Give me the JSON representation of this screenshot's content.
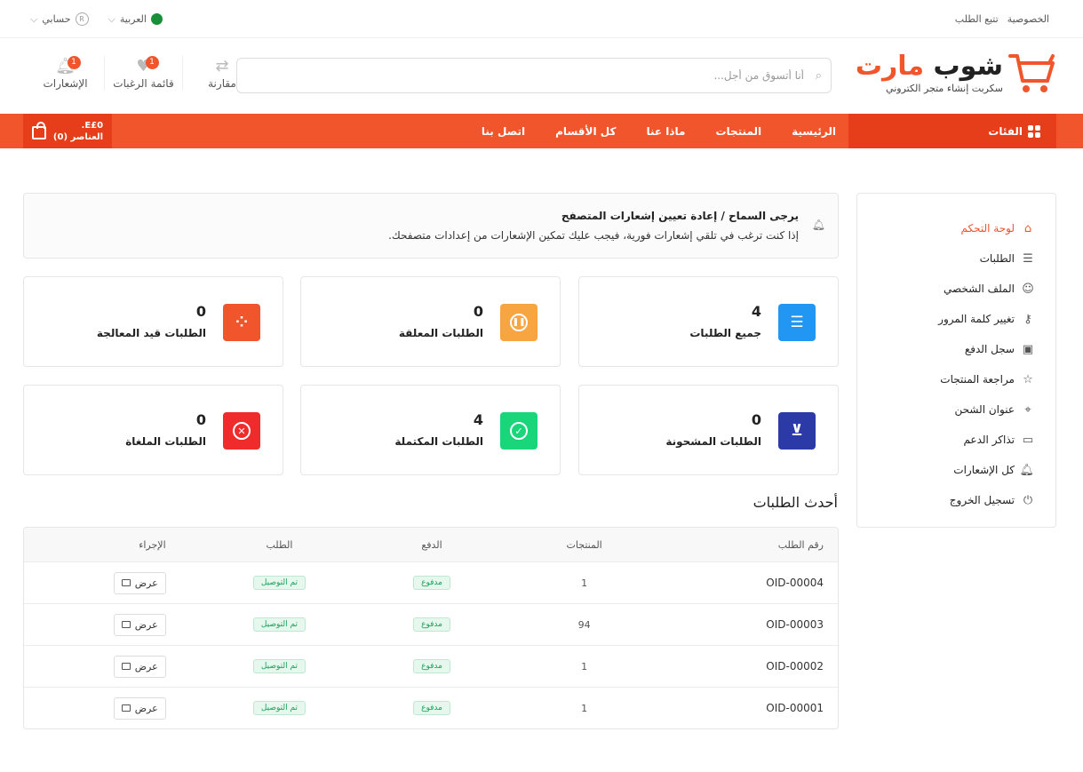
{
  "topbar": {
    "privacy": "الخصوصية",
    "track_order": "تتبع الطلب",
    "language": "العربية",
    "account": "حسابي"
  },
  "header": {
    "logo_part1": "شوب",
    "logo_part2": "مارت",
    "tagline": "سكربت إنشاء متجر الكتروني",
    "search_placeholder": "أنا أتسوق من أجل...",
    "compare_label": "مقارنة",
    "wishlist_label": "قائمة الرغبات",
    "wishlist_count": "1",
    "notifications_label": "الإشعارات",
    "notifications_count": "1"
  },
  "nav": {
    "categories": "الفئات",
    "links": [
      "الرئيسية",
      "المنتجات",
      "ماذا عنا",
      "كل الأقسام",
      "اتصل بنا"
    ],
    "cart_total": "E£0.",
    "cart_items": "العناصر (0)"
  },
  "sidebar": {
    "items": [
      {
        "label": "لوحة التحكم",
        "icon": "home-icon"
      },
      {
        "label": "الطلبات",
        "icon": "list-icon"
      },
      {
        "label": "الملف الشخصي",
        "icon": "user-icon"
      },
      {
        "label": "تغيير كلمة المرور",
        "icon": "key-icon"
      },
      {
        "label": "سجل الدفع",
        "icon": "money-icon"
      },
      {
        "label": "مراجعة المنتجات",
        "icon": "star-icon"
      },
      {
        "label": "عنوان الشحن",
        "icon": "location-icon"
      },
      {
        "label": "تذاكر الدعم",
        "icon": "ticket-icon"
      },
      {
        "label": "كل الإشعارات",
        "icon": "bell-icon"
      },
      {
        "label": "تسجيل الخروج",
        "icon": "logout-icon"
      }
    ]
  },
  "alert": {
    "title": "يرجى السماح / إعادة تعيين إشعارات المتصفح",
    "text": "إذا كنت ترغب في تلقي إشعارات فورية، فيجب عليك تمكين الإشعارات من إعدادات متصفحك."
  },
  "stats": [
    {
      "label": "جميع الطلبات",
      "value": "4",
      "color": "#2196f3",
      "icon": "list-icon"
    },
    {
      "label": "الطلبات المعلقة",
      "value": "0",
      "color": "#f7a541",
      "icon": "pause-icon"
    },
    {
      "label": "الطلبات قيد المعالجة",
      "value": "0",
      "color": "#f1552c",
      "icon": "spinner-icon"
    },
    {
      "label": "الطلبات المشحونة",
      "value": "0",
      "color": "#2c3aa8",
      "icon": "basket-icon"
    },
    {
      "label": "الطلبات المكتملة",
      "value": "4",
      "color": "#19d67a",
      "icon": "check-icon"
    },
    {
      "label": "الطلبات الملغاة",
      "value": "0",
      "color": "#ef2b2b",
      "icon": "close-icon"
    }
  ],
  "recent": {
    "title": "أحدث الطلبات",
    "headers": [
      "رقم الطلب",
      "المنتجات",
      "الدفع",
      "الطلب",
      "الإجراء"
    ],
    "rows": [
      {
        "id": "OID-00004",
        "products": "1",
        "payment": "مدفوع",
        "status": "تم التوصيل",
        "action": "عرض"
      },
      {
        "id": "OID-00003",
        "products": "94",
        "payment": "مدفوع",
        "status": "تم التوصيل",
        "action": "عرض"
      },
      {
        "id": "OID-00002",
        "products": "1",
        "payment": "مدفوع",
        "status": "تم التوصيل",
        "action": "عرض"
      },
      {
        "id": "OID-00001",
        "products": "1",
        "payment": "مدفوع",
        "status": "تم التوصيل",
        "action": "عرض"
      }
    ]
  }
}
